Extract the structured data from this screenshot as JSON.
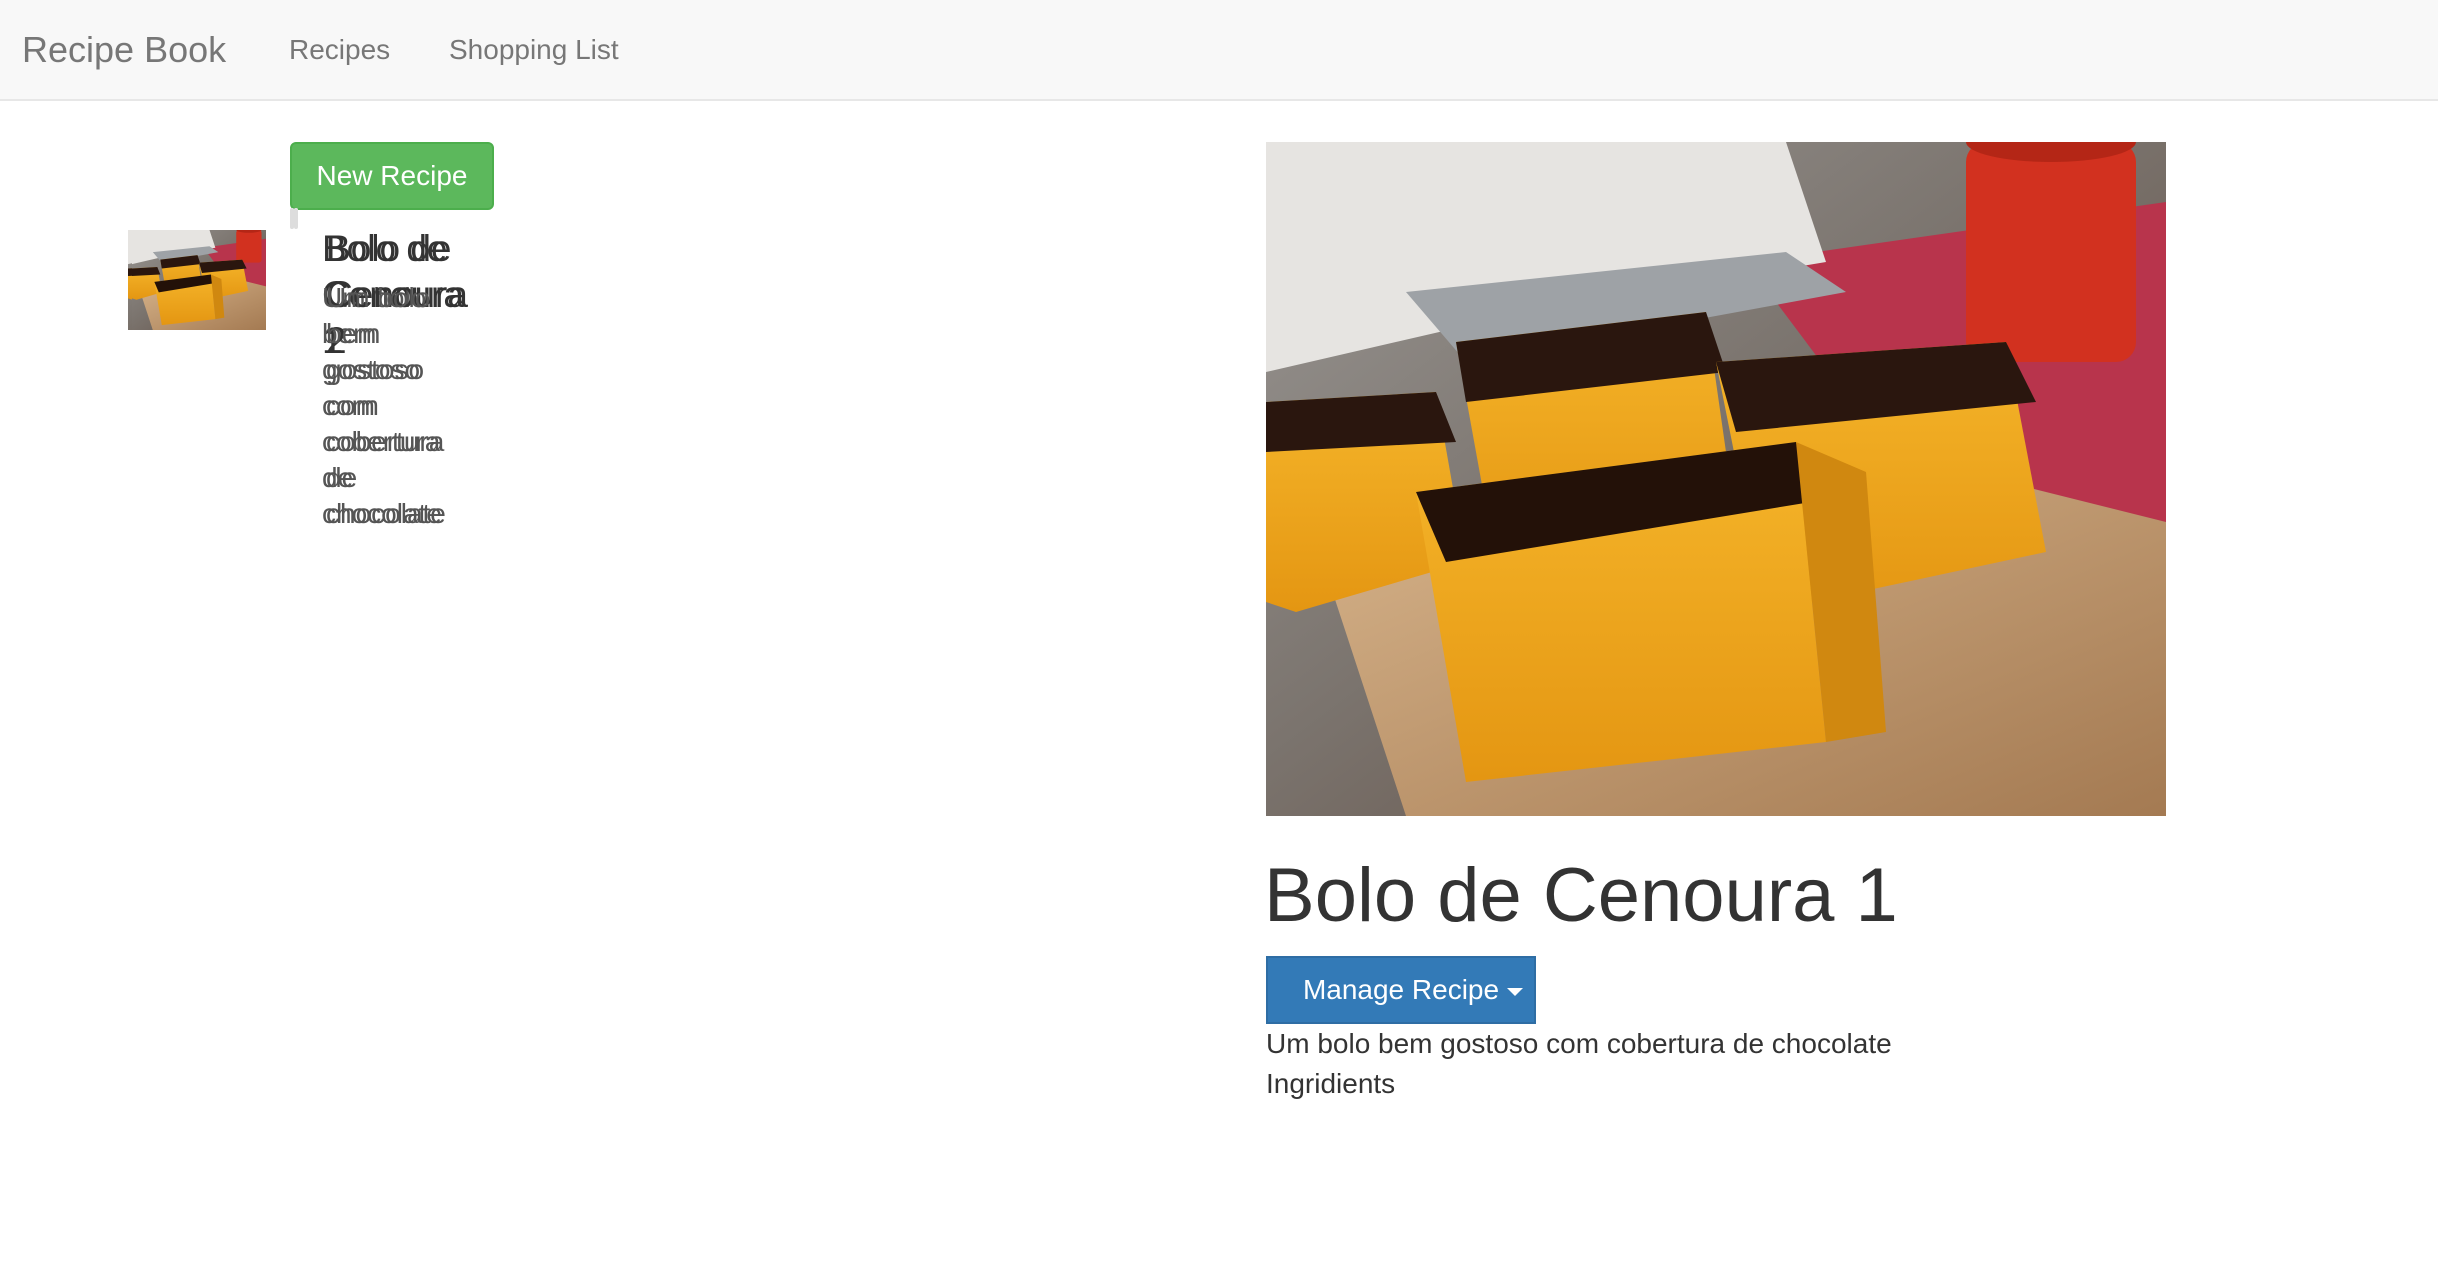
{
  "navbar": {
    "brand": "Recipe Book",
    "links": [
      "Recipes",
      "Shopping List"
    ]
  },
  "recipes_panel": {
    "new_button": "New Recipe",
    "items": [
      {
        "title": "Bolo de Cenoura 1",
        "description": "Um bolo bem gostoso com cobertura de chocolate",
        "active": true
      },
      {
        "title": "Bolo de Cenoura 2",
        "description": "Um bolo bem gostoso com cobertura de chocolate",
        "active": false
      }
    ]
  },
  "detail": {
    "title": "Bolo de Cenoura 1",
    "manage_button": "Manage Recipe",
    "description": "Um bolo bem gostoso com cobertura de chocolate",
    "ingredients_heading": "Ingridients"
  },
  "colors": {
    "success": "#5cb85c",
    "primary": "#337ab7",
    "navbar_bg": "#f8f8f8",
    "cake": "#f0a818",
    "chocolate": "#2a160e",
    "board": "#c9a37a",
    "cloth": "#b8344c"
  }
}
